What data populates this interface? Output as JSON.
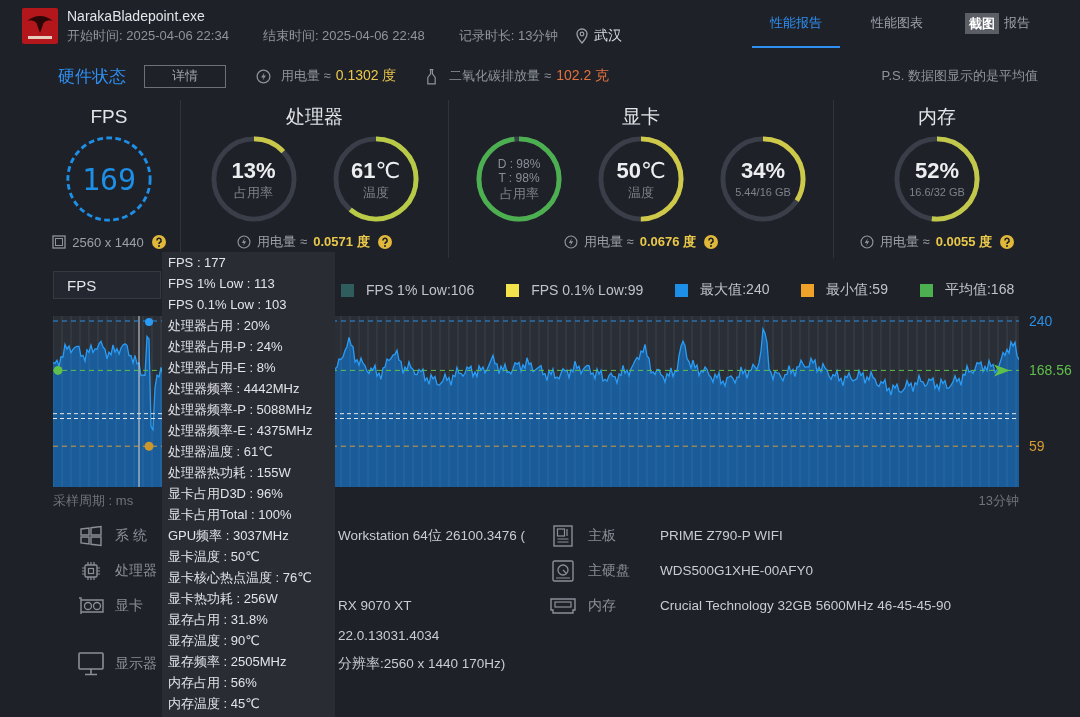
{
  "window": {
    "title": "NarakaBladepoint.exe",
    "start_time": "开始时间: 2025-04-06 22:34",
    "end_time": "结束时间: 2025-04-06 22:48",
    "duration": "记录时长: 13分钟",
    "location": "武汉"
  },
  "tabs": [
    {
      "label": "性能报告",
      "selected": true
    },
    {
      "label": "性能图表",
      "selected": false
    },
    {
      "label": "报告",
      "selected": false
    }
  ],
  "screenshot_button": {
    "label": "截图"
  },
  "summary": {
    "title": "硬件状态",
    "details_button": "详情",
    "power_label": "用电量 ≈",
    "power_value": "0.1302 度",
    "co2_label": "二氧化碳排放量 ≈",
    "co2_value": "102.2 克",
    "note": "P.S. 数据图显示的是平均值"
  },
  "groups": [
    {
      "title": "FPS",
      "gauges": [
        {
          "kind": "fps",
          "value": "169"
        }
      ],
      "footer": {
        "kind": "resolution",
        "text": "2560 x 1440"
      }
    },
    {
      "title": "处理器",
      "gauges": [
        {
          "kind": "ring",
          "value": "13%",
          "caption": "占用率",
          "level": 0.13,
          "color": "#c9c74a"
        },
        {
          "kind": "ring",
          "value": "61",
          "unit": "℃",
          "caption": "温度",
          "level": 0.61,
          "color": "#b9cb46"
        }
      ],
      "footer": {
        "kind": "power",
        "label": "用电量 ≈",
        "value": "0.0571 度"
      }
    },
    {
      "title": "显卡",
      "gauges": [
        {
          "kind": "dual",
          "lines": [
            "D : 98%",
            "T : 98%"
          ],
          "caption": "占用率",
          "level": 0.98,
          "color": "#4caf50"
        },
        {
          "kind": "ring",
          "value": "50",
          "unit": "℃",
          "caption": "温度",
          "level": 0.5,
          "color": "#cfc94a"
        },
        {
          "kind": "ring",
          "value": "34%",
          "caption": "5.44/16 GB",
          "level": 0.34,
          "color": "#cfc94a"
        }
      ],
      "footer": {
        "kind": "power",
        "label": "用电量 ≈",
        "value": "0.0676 度"
      }
    },
    {
      "title": "内存",
      "gauges": [
        {
          "kind": "ring",
          "value": "52%",
          "caption": "16.6/32 GB",
          "level": 0.52,
          "color": "#c2c84a"
        }
      ],
      "footer": {
        "kind": "power",
        "label": "用电量 ≈",
        "value": "0.0055 度"
      }
    }
  ],
  "chart": {
    "selector": "FPS",
    "legend": [
      {
        "label": "FPS 1% Low:106",
        "color": "#2f5c5c"
      },
      {
        "label": "FPS 0.1% Low:99",
        "color": "#f2e34c"
      },
      {
        "label": "最大值:240",
        "color": "#1d8fe8"
      },
      {
        "label": "最小值:59",
        "color": "#f0a12a"
      },
      {
        "label": "平均值:168",
        "color": "#4caf50"
      }
    ],
    "markers": [
      {
        "kind": "max",
        "label": "240"
      },
      {
        "kind": "avg",
        "label": "168.56"
      },
      {
        "kind": "min",
        "label": "59"
      }
    ],
    "x_caption": "采样周期 : ms",
    "x_end": "13分钟"
  },
  "tooltip": {
    "lines": [
      "FPS : 177",
      "FPS 1% Low : 113",
      "FPS 0.1% Low : 103",
      "处理器占用 : 20%",
      "处理器占用-P : 24%",
      "处理器占用-E : 8%",
      "处理器频率 : 4442MHz",
      "处理器频率-P : 5088MHz",
      "处理器频率-E : 4375MHz",
      "处理器温度 : 61℃",
      "处理器热功耗 : 155W",
      "显卡占用D3D : 96%",
      "显卡占用Total : 100%",
      "GPU频率 : 3037MHz",
      "显卡温度 : 50℃",
      "显卡核心热点温度 : 76℃",
      "显卡热功耗 : 256W",
      "显存占用 : 31.8%",
      "显存温度 : 90℃",
      "显存频率 : 2505MHz",
      "内存占用 : 56%",
      "内存温度 : 45℃"
    ]
  },
  "hardware": {
    "left": [
      {
        "kind": "system",
        "label": "系 统",
        "value": "Workstation 64位 26100.3476 ("
      },
      {
        "kind": "cpu",
        "label": "处理器"
      },
      {
        "kind": "gpu",
        "label": "显卡",
        "value": "RX 9070 XT"
      },
      {
        "kind": "driver",
        "value": "22.0.13031.4034"
      },
      {
        "kind": "display",
        "label": "显示器",
        "value": "分辨率:2560 x 1440 170Hz)"
      }
    ],
    "right": [
      {
        "kind": "board",
        "label": "主板",
        "value": "PRIME Z790-P WIFI"
      },
      {
        "kind": "disk",
        "label": "主硬盘",
        "value": "WDS500G1XHE-00AFY0"
      },
      {
        "kind": "memory",
        "label": "内存",
        "value": "Crucial Technology 32GB 5600MHz 46-45-45-90"
      }
    ]
  }
}
